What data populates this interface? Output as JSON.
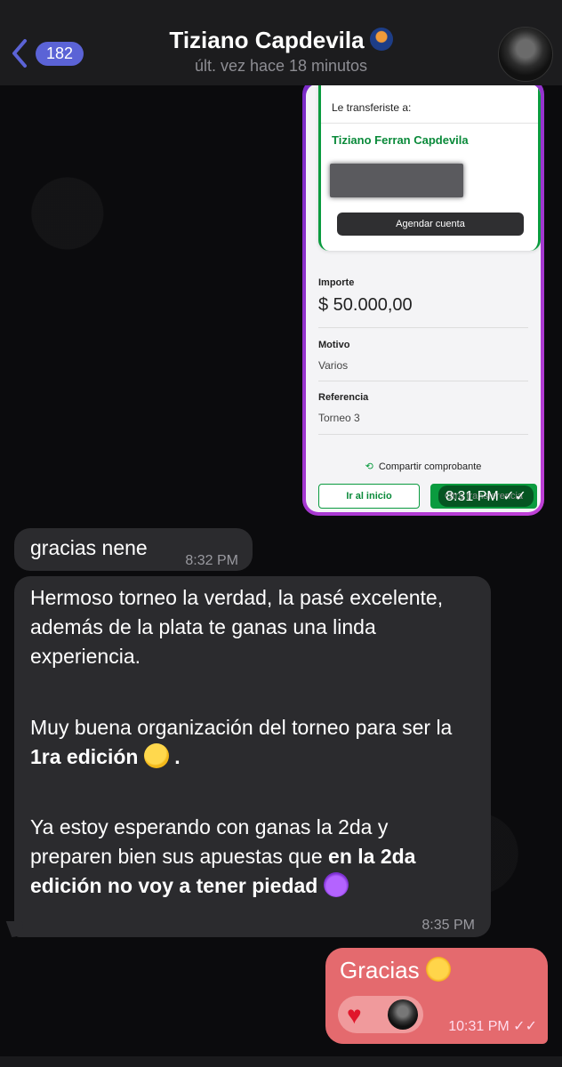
{
  "header": {
    "back_count": "182",
    "title": "Tiziano Capdevila",
    "subtitle": "últ. vez hace 18 minutos"
  },
  "receipt": {
    "transfer_label": "Le transferiste a:",
    "recipient_name": "Tiziano Ferran Capdevila",
    "agendar_label": "Agendar cuenta",
    "importe_label": "Importe",
    "importe_value": "$ 50.000,00",
    "motivo_label": "Motivo",
    "motivo_value": "Varios",
    "referencia_label": "Referencia",
    "referencia_value": "Torneo 3",
    "share_label": "Compartir comprobante",
    "btn_inicio": "Ir al inicio",
    "btn_otra": "Otra transferencia",
    "time": "8:31 PM ✓✓"
  },
  "messages": {
    "m1_text": "gracias nene",
    "m1_time": "8:32 PM",
    "m2_p1": "Hermoso torneo la verdad, la pasé excelente, además de la plata te ganas una linda experiencia.",
    "m2_p2_pre": "Muy buena organización del torneo para ser la ",
    "m2_p2_bold": "1ra edición",
    "m2_p2_post": ".",
    "m2_p3_pre": "Ya estoy esperando con ganas la 2da y preparen bien sus apuestas que ",
    "m2_p3_bold": "en la 2da edición no voy a tener piedad",
    "m2_time": "8:35 PM",
    "m3_text": "Gracias",
    "m3_time": "10:31 PM ✓✓"
  },
  "icons": [
    "back-chevron-icon",
    "basketball-icon",
    "share-icon",
    "duck-emoji-icon",
    "devil-emoji-icon",
    "star-eyes-emoji-icon",
    "heart-reaction-icon"
  ]
}
